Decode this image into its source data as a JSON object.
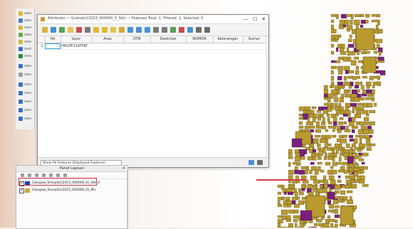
{
  "window": {
    "title": "Attributes — Graha(b)(2023_000000_0_Stk) — Features Total: 1, Filtered: 1, Selected: 0",
    "minimize": "—",
    "maximize": "☐",
    "close": "✕"
  },
  "table": {
    "columns": [
      "fid",
      "layer",
      "Area",
      "UTM",
      "Deskripsi",
      "NOMOR",
      "Keterangan",
      "Sumur"
    ],
    "rows": [
      [
        "",
        "HHLFE31KFFAT",
        "",
        "",
        "",
        "",
        "",
        ""
      ]
    ]
  },
  "status": {
    "filter_label": "Show All Features (Displayed Features)"
  },
  "layers_panel": {
    "title": "Panel Lapisan",
    "close": "✕",
    "items": [
      {
        "name": "Glasgow_Sharp(b)(2023_000000_0)_Stk_0",
        "color": "#1f3fa6",
        "checked": "✓"
      },
      {
        "name": "Glasgow_Sharp(b)(2023_000000_0)_Mu",
        "color": "#c9a73a",
        "checked": "✓"
      }
    ]
  },
  "colors": {
    "parcel_fill": "#b89a2e",
    "parcel_selected": "#7a1f7e",
    "highlight": "#d33a4e"
  },
  "icons": [
    "save-icon",
    "edit-icon",
    "delete-icon",
    "select-icon",
    "filter-icon",
    "zoom-icon",
    "copy-icon",
    "paste-icon",
    "calculator-icon",
    "column-icon",
    "conditional-format-icon",
    "dock-icon"
  ]
}
